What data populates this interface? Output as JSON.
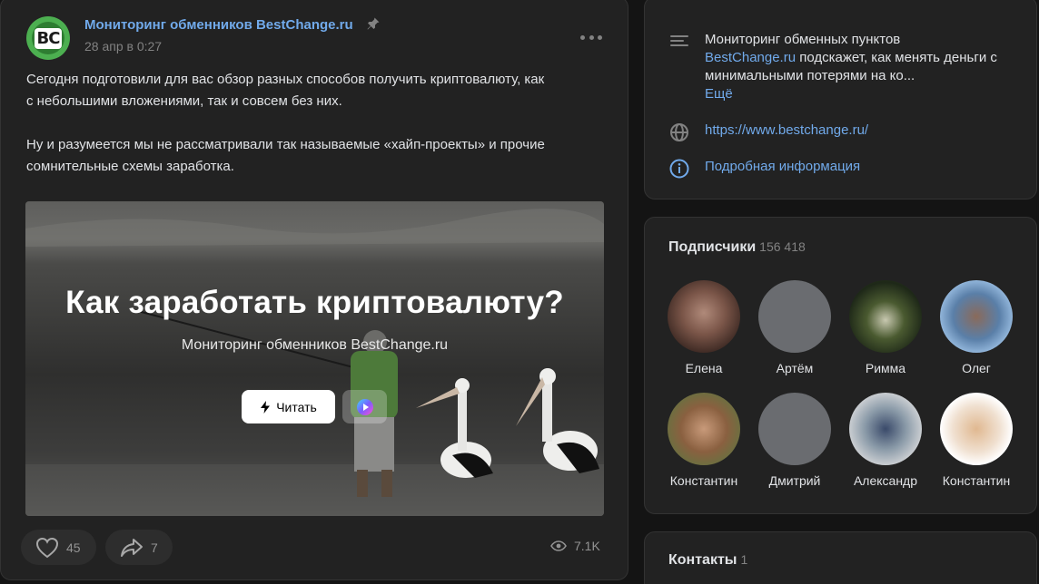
{
  "post": {
    "group_name": "Мониторинг обменников BestChange.ru",
    "date": "28 апр в 0:27",
    "logo_text": "BC",
    "text_lines_1": [
      "Сегодня подготовили для вас обзор разных способов получить криптовалюту, как",
      "с небольшими вложениями, так и совсем без них."
    ],
    "text_lines_2": [
      "Ну и разумеется мы не рассматривали так называемые «хайп-проекты» и прочие",
      "сомнительные схемы заработка."
    ],
    "article": {
      "title": "Как заработать криптовалюту?",
      "subtitle": "Мониторинг обменников BestChange.ru",
      "read_label": "Читать"
    },
    "likes": "45",
    "shares": "7",
    "views": "7.1K"
  },
  "info": {
    "desc_line1": "Мониторинг обменных пунктов",
    "desc_link": "BestChange.ru",
    "desc_rest": " подскажет, как менять деньги с минимальными потерями на ко...",
    "more": "Ещё",
    "website": "https://www.bestchange.ru/",
    "details": "Подробная информация"
  },
  "subscribers": {
    "title": "Подписчики",
    "count": "156 418",
    "items": [
      {
        "name": "Елена"
      },
      {
        "name": "Артём"
      },
      {
        "name": "Римма"
      },
      {
        "name": "Олег"
      },
      {
        "name": "Константин"
      },
      {
        "name": "Дмитрий"
      },
      {
        "name": "Александр"
      },
      {
        "name": "Константин"
      }
    ]
  },
  "contacts": {
    "title": "Контакты",
    "count": "1"
  },
  "colors": {
    "accent": "#71aaeb",
    "card_bg": "#222222",
    "page_bg": "#141414"
  }
}
